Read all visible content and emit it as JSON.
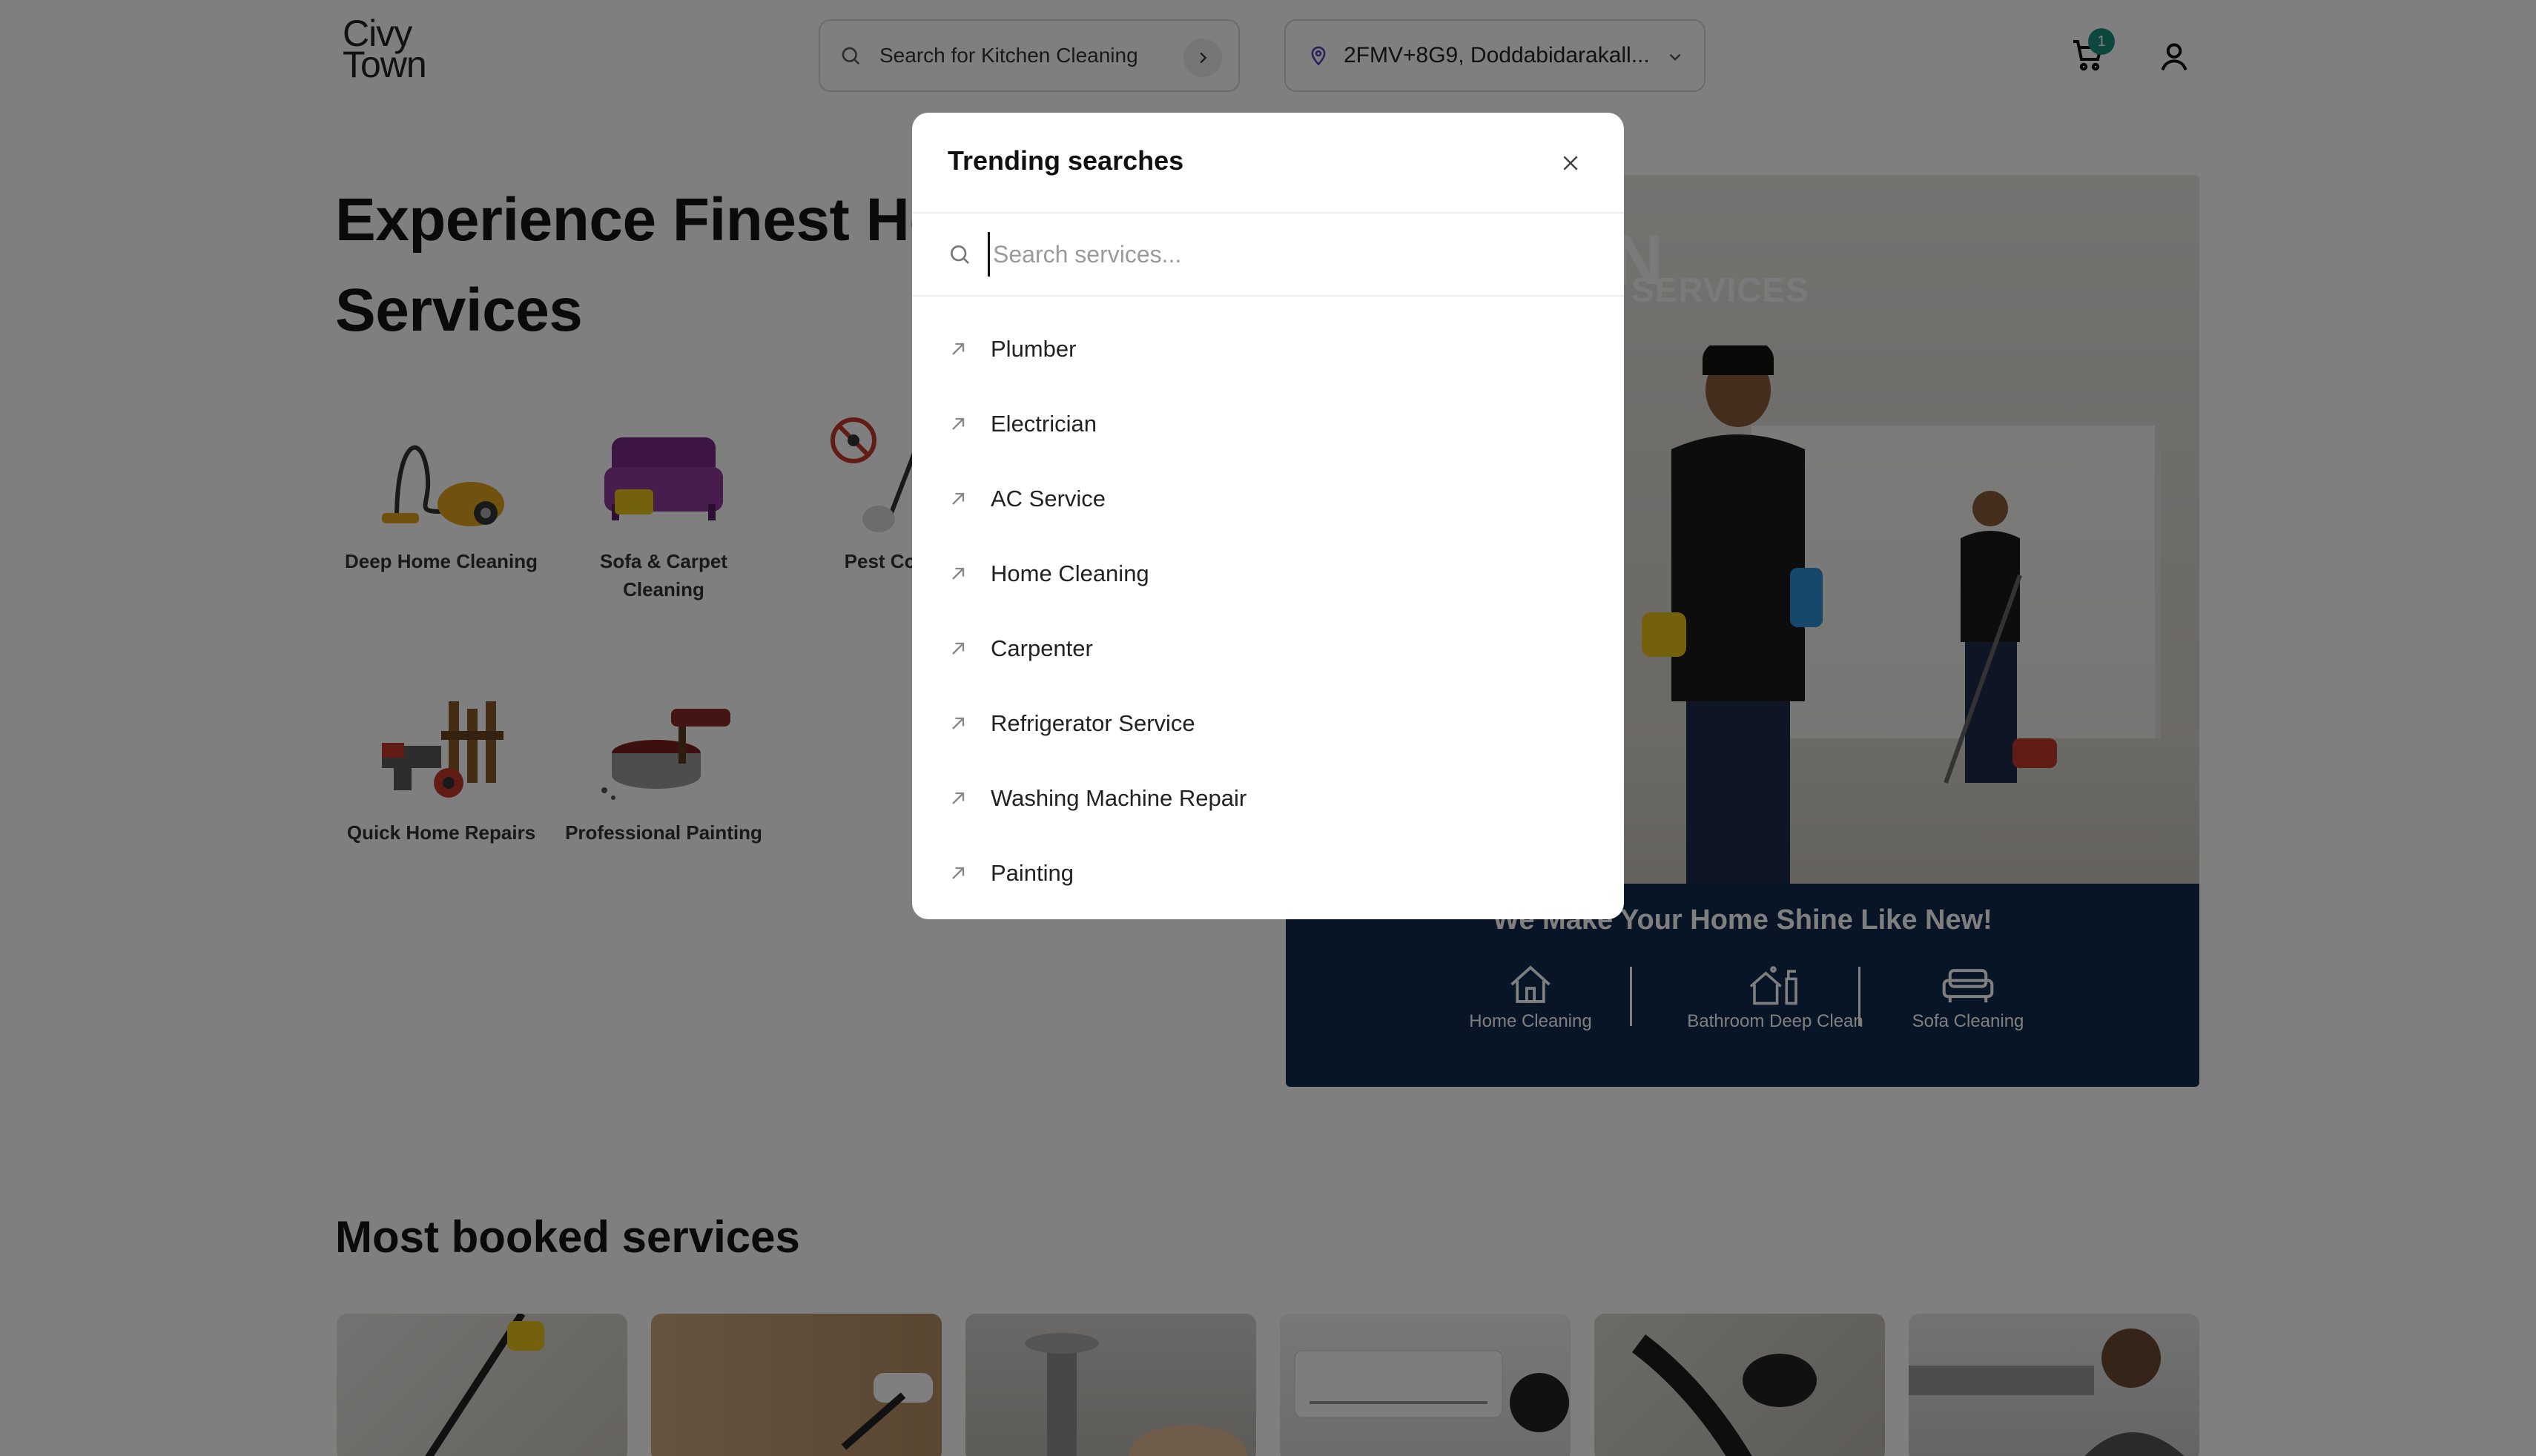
{
  "header": {
    "logo_line1": "Civy",
    "logo_line2": "Town",
    "search_text": "Search for Kitchen Cleaning",
    "location_text": "2FMV+8G9, Doddabidarakall...",
    "cart_count": "1"
  },
  "hero": {
    "title_line1": "Experience Finest Hor",
    "title_line2": "Services",
    "categories": [
      {
        "label_line1": "Deep Home Cleaning",
        "label_line2": ""
      },
      {
        "label_line1": "Sofa & Carpet",
        "label_line2": "Cleaning"
      },
      {
        "label_line1": "Pest Con",
        "label_line2": ""
      },
      {
        "label_line1": "Quick Home Repairs",
        "label_line2": ""
      },
      {
        "label_line1": "Professional Painting",
        "label_line2": ""
      }
    ]
  },
  "banner": {
    "brand_big": "N",
    "brand_small": "SERVICES",
    "tagline": "We Make Your Home Shine Like New!",
    "features": [
      "Home Cleaning",
      "Bathroom Deep Clean",
      "Sofa Cleaning"
    ]
  },
  "most_booked": {
    "title": "Most booked services"
  },
  "modal": {
    "title": "Trending searches",
    "search_placeholder": "Search services...",
    "items": [
      "Plumber",
      "Electrician",
      "AC Service",
      "Home Cleaning",
      "Carpenter",
      "Refrigerator Service",
      "Washing Machine Repair",
      "Painting"
    ]
  }
}
